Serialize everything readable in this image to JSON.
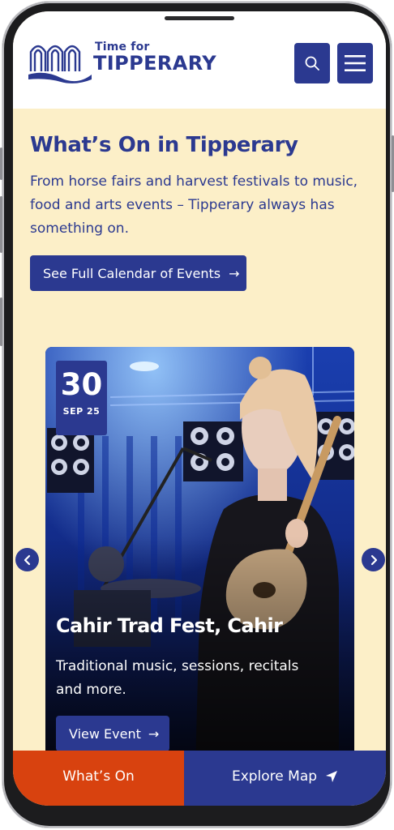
{
  "header": {
    "logo_small": "Time for",
    "logo_big": "TIPPERARY",
    "search_icon": "search-icon",
    "menu_icon": "hamburger-menu-icon"
  },
  "intro": {
    "title": "What’s On in Tipperary",
    "text": "From horse fairs and harvest festivals to music, food and arts events – Tipperary always has something on.",
    "calendar_button": "See Full Calendar of Events",
    "calendar_arrow": "→"
  },
  "event": {
    "day": "30",
    "month_year": "SEP 25",
    "title": "Cahir Trad Fest, Cahir",
    "description": "Traditional music, sessions, recitals and more.",
    "button": "View Event",
    "button_arrow": "→"
  },
  "carousel": {
    "prev_icon": "chevron-left-icon",
    "next_icon": "chevron-right-icon"
  },
  "bottom_bar": {
    "whats_on": "What’s On",
    "explore_map": "Explore Map",
    "map_icon": "navigation-arrow-icon"
  },
  "colors": {
    "brand_navy": "#2b3990",
    "accent_orange": "#d8420f",
    "background_cream": "#fcefc8"
  }
}
